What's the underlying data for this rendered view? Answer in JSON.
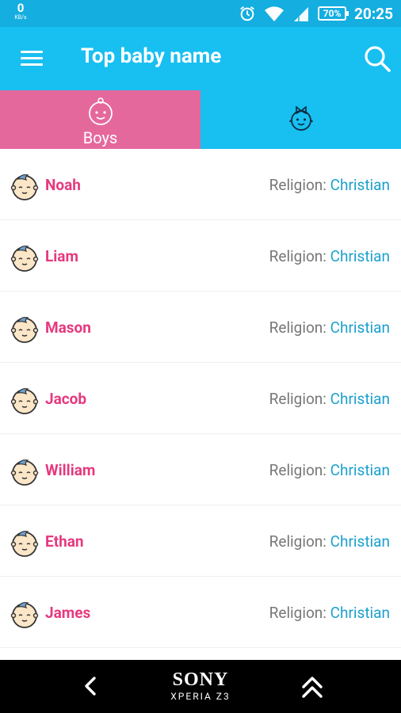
{
  "status_bar": {
    "speed_value": "0",
    "speed_unit": "KB/s",
    "battery": "70%",
    "time": "20:25"
  },
  "app_bar": {
    "title": "Top baby name",
    "menu_icon": "hamburger-menu-icon",
    "search_icon": "search-icon"
  },
  "tabs": [
    {
      "label": "Boys",
      "icon": "baby-boy-icon",
      "selected": true,
      "color": "#e5689d"
    },
    {
      "label": "",
      "icon": "baby-girl-icon",
      "selected": false,
      "color": "#18bff1"
    }
  ],
  "religion_label": "Religion: ",
  "names": [
    {
      "name": "Noah",
      "religion": "Christian"
    },
    {
      "name": "Liam",
      "religion": "Christian"
    },
    {
      "name": "Mason",
      "religion": "Christian"
    },
    {
      "name": "Jacob",
      "religion": "Christian"
    },
    {
      "name": "William",
      "religion": "Christian"
    },
    {
      "name": "Ethan",
      "religion": "Christian"
    },
    {
      "name": "James",
      "religion": "Christian"
    }
  ],
  "nav_bar": {
    "brand": "SONY",
    "model": "XPERIA Z3"
  },
  "colors": {
    "primary": "#18bff1",
    "status_bar": "#14aee0",
    "boys_tab": "#e5689d",
    "name_text": "#e6397f",
    "religion_value": "#1ba0cd"
  }
}
